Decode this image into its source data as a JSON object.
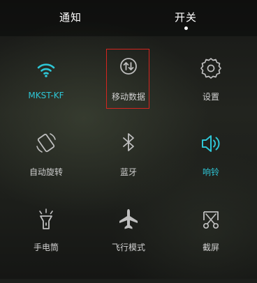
{
  "tabs": {
    "notify_label": "通知",
    "switch_label": "开关",
    "active": "开关"
  },
  "tiles": [
    {
      "label": "MKST-KF",
      "icon": "wifi-icon",
      "active": true
    },
    {
      "label": "移动数据",
      "icon": "mobile-data-icon",
      "active": false
    },
    {
      "label": "设置",
      "icon": "settings-gear-icon",
      "active": false
    },
    {
      "label": "自动旋转",
      "icon": "auto-rotate-icon",
      "active": false
    },
    {
      "label": "蓝牙",
      "icon": "bluetooth-icon",
      "active": false
    },
    {
      "label": "响铃",
      "icon": "ring-volume-icon",
      "active": true
    },
    {
      "label": "手电筒",
      "icon": "flashlight-icon",
      "active": false
    },
    {
      "label": "飞行模式",
      "icon": "airplane-mode-icon",
      "active": false
    },
    {
      "label": "截屏",
      "icon": "screenshot-icon",
      "active": false
    }
  ],
  "colors": {
    "active": "#2ec6d6",
    "inactive_icon": "#bfbfbf",
    "inactive_label": "#d0d0d0",
    "highlight_box": "#d6251f"
  }
}
